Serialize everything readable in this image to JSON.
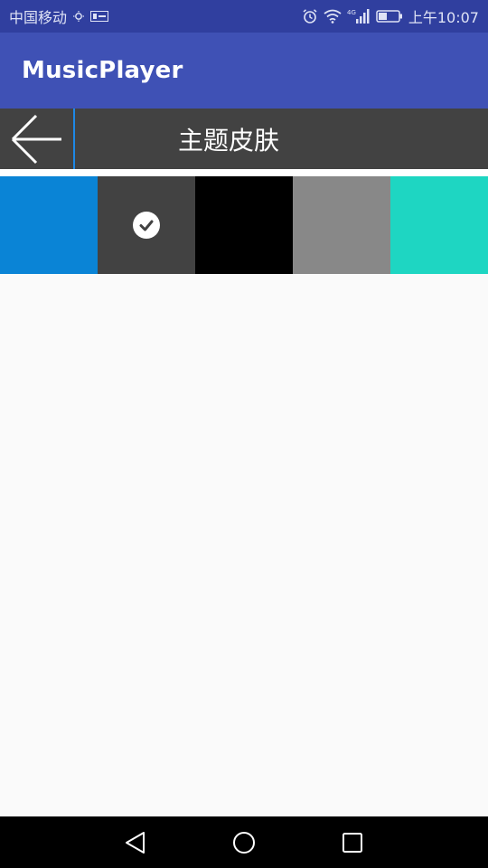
{
  "status_bar": {
    "carrier": "中国移动",
    "time": "上午10:07",
    "icons": [
      "usb-debug-icon",
      "notification-icon",
      "alarm-icon",
      "wifi-icon",
      "4g-signal-icon",
      "battery-icon"
    ]
  },
  "app_bar": {
    "title": "MusicPlayer"
  },
  "title_bar": {
    "title": "主题皮肤",
    "back_icon": "arrow-left-icon"
  },
  "swatches": [
    {
      "name": "blue",
      "color": "#0a84d6",
      "selected": false
    },
    {
      "name": "dark-gray",
      "color": "#424242",
      "selected": true
    },
    {
      "name": "black",
      "color": "#000000",
      "selected": false
    },
    {
      "name": "gray",
      "color": "#888888",
      "selected": false
    },
    {
      "name": "teal",
      "color": "#1ed6c2",
      "selected": false
    }
  ],
  "nav_bar": {
    "icons": [
      "back-triangle-icon",
      "home-circle-icon",
      "recents-square-icon"
    ]
  },
  "colors": {
    "status_bar": "#303f9f",
    "app_bar": "#3f51b5",
    "title_bar": "#424242",
    "accent_divider": "#1e88e5",
    "background": "#fafafa"
  }
}
